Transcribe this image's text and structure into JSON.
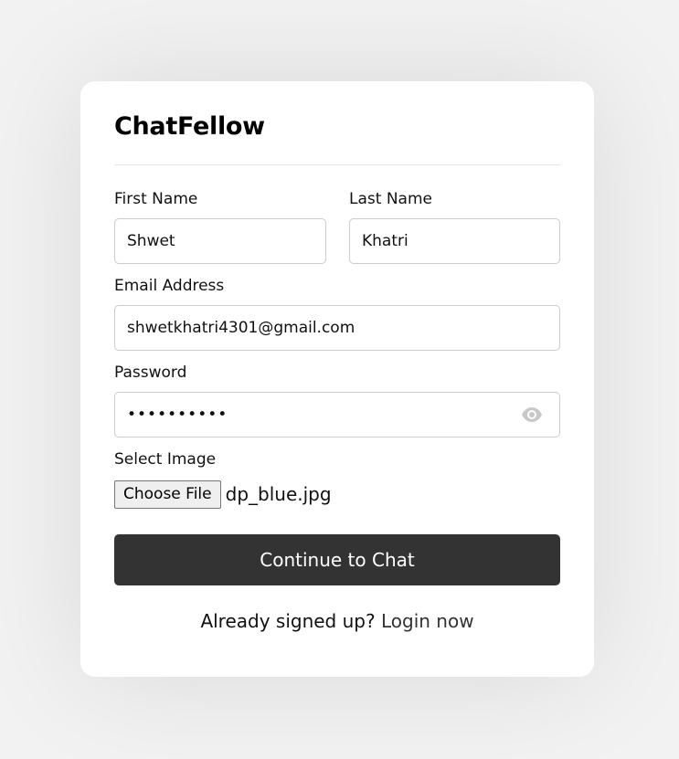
{
  "app": {
    "title": "ChatFellow"
  },
  "form": {
    "first_name": {
      "label": "First Name",
      "value": "Shwet"
    },
    "last_name": {
      "label": "Last Name",
      "value": "Khatri"
    },
    "email": {
      "label": "Email Address",
      "value": "shwetkhatri4301@gmail.com"
    },
    "password": {
      "label": "Password",
      "value": "••••••••••",
      "toggle_icon": "eye-icon"
    },
    "image": {
      "label": "Select Image",
      "button_label": "Choose File",
      "file_name": "dp_blue.jpg"
    },
    "submit_label": "Continue to Chat"
  },
  "footer": {
    "prompt": "Already signed up? ",
    "link_label": "Login now"
  },
  "colors": {
    "background": "#f2f2f2",
    "card": "#ffffff",
    "button": "#333333",
    "input_border": "#cccccc"
  }
}
